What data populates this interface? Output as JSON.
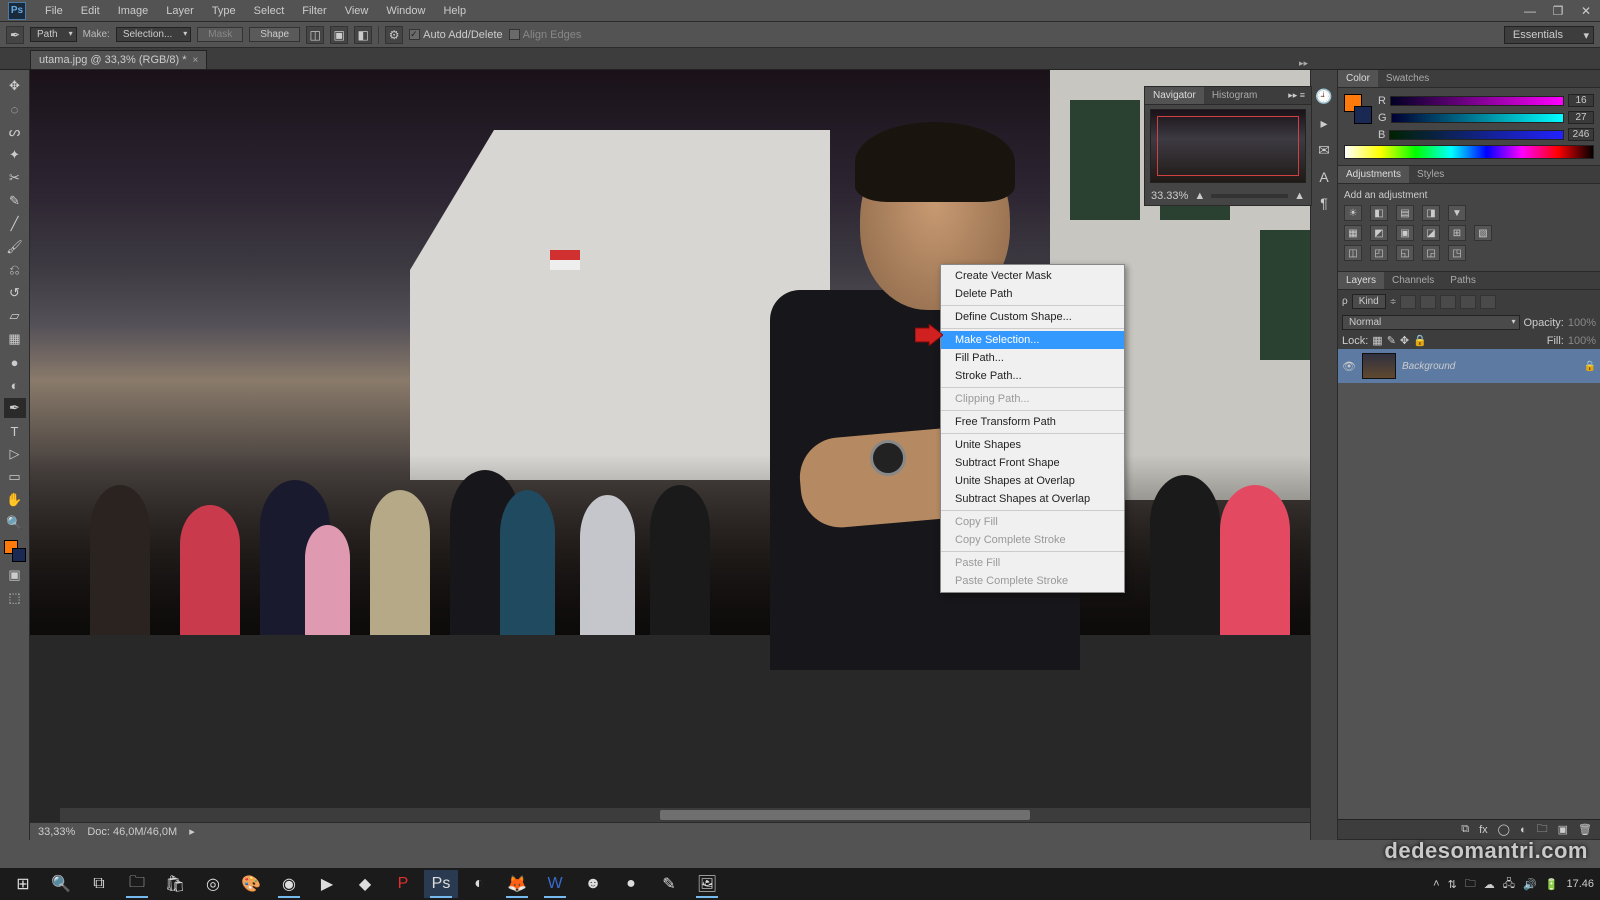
{
  "menubar": [
    "File",
    "Edit",
    "Image",
    "Layer",
    "Type",
    "Select",
    "Filter",
    "View",
    "Window",
    "Help"
  ],
  "optbar": {
    "path_dd": "Path",
    "make_lbl": "Make:",
    "make_dd": "Selection...",
    "mask_btn": "Mask",
    "shape_btn": "Shape",
    "autoadd": "Auto Add/Delete",
    "align": "Align Edges",
    "workspace": "Essentials"
  },
  "doctab": {
    "title": "utama.jpg @ 33,3% (RGB/8) *"
  },
  "ctx": {
    "groups": [
      [
        "Create Vecter Mask",
        "Delete Path"
      ],
      [
        "Define Custom Shape..."
      ],
      [
        "Make Selection...",
        "Fill Path...",
        "Stroke Path..."
      ],
      [
        "Clipping Path..."
      ],
      [
        "Free Transform Path"
      ],
      [
        "Unite Shapes",
        "Subtract Front Shape",
        "Unite Shapes at Overlap",
        "Subtract Shapes at Overlap"
      ],
      [
        "Copy Fill",
        "Copy Complete Stroke"
      ],
      [
        "Paste Fill",
        "Paste Complete Stroke"
      ]
    ],
    "selected": "Make Selection...",
    "disabled": [
      "Clipping Path...",
      "Copy Fill",
      "Copy Complete Stroke",
      "Paste Fill",
      "Paste Complete Stroke"
    ]
  },
  "status": {
    "zoom": "33,33%",
    "doc": "Doc: 46,0M/46,0M"
  },
  "nav": {
    "tabs": [
      "Navigator",
      "Histogram"
    ],
    "zoom": "33.33%"
  },
  "color": {
    "tabs": [
      "Color",
      "Swatches"
    ],
    "channels": [
      {
        "l": "R",
        "v": "16",
        "grad": "linear-gradient(90deg,#002,#f0f)"
      },
      {
        "l": "G",
        "v": "27",
        "grad": "linear-gradient(90deg,#003,#0ff)"
      },
      {
        "l": "B",
        "v": "246",
        "grad": "linear-gradient(90deg,#020,#22f)"
      }
    ]
  },
  "adjust": {
    "tabs": [
      "Adjustments",
      "Styles"
    ],
    "heading": "Add an adjustment"
  },
  "layers": {
    "tabs": [
      "Layers",
      "Channels",
      "Paths"
    ],
    "kind": "Kind",
    "mode": "Normal",
    "opacity_lbl": "Opacity:",
    "opacity": "100%",
    "lock_lbl": "Lock:",
    "fill_lbl": "Fill:",
    "fill": "100%",
    "layer_name": "Background"
  },
  "taskbar": {
    "time": "17.46",
    "watermark": "dedesomantri.com"
  }
}
